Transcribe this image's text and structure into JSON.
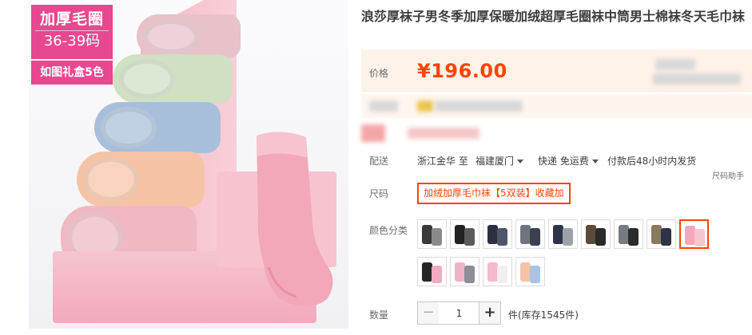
{
  "badge": {
    "line1": "加厚毛圈",
    "line2": "36-39码",
    "sub": "如图礼盒5色"
  },
  "product": {
    "title": "浪莎厚袜子男冬季加厚保暖加绒超厚毛圈袜中筒男士棉袜冬天毛巾袜"
  },
  "price": {
    "label": "价格",
    "value": "¥196.00"
  },
  "shipping": {
    "label": "配送",
    "from": "浙江金华 至",
    "to": "福建厦门",
    "method": "快递 免运费",
    "time": "付款后48小时内发货"
  },
  "size": {
    "helper": "尺码助手",
    "label": "尺码",
    "selected_option": "加绒加厚毛巾袜【5双装】收藏加"
  },
  "colors": {
    "label": "颜色分类",
    "swatches": [
      {
        "name": "mix-gray-black",
        "c1": "#3a3a3a",
        "c2": "#8a8a8a"
      },
      {
        "name": "black-gray",
        "c1": "#222222",
        "c2": "#5a5a5a"
      },
      {
        "name": "navy-black",
        "c1": "#2b3040",
        "c2": "#4d5566"
      },
      {
        "name": "gray-navy",
        "c1": "#6f7580",
        "c2": "#3a4050"
      },
      {
        "name": "navy-gray",
        "c1": "#2e3548",
        "c2": "#9ea2a8"
      },
      {
        "name": "brown-black",
        "c1": "#5b4a3a",
        "c2": "#2a2a2a"
      },
      {
        "name": "gray-black",
        "c1": "#777a80",
        "c2": "#2b2b2b"
      },
      {
        "name": "khaki-navy",
        "c1": "#8a7a5e",
        "c2": "#2d3446"
      },
      {
        "name": "pink-gift-box",
        "c1": "#f2a8b8",
        "c2": "#f7c6d1"
      },
      {
        "name": "black-pink",
        "c1": "#262626",
        "c2": "#f3aac0"
      },
      {
        "name": "pink-gray",
        "c1": "#f0b3c4",
        "c2": "#8d8d95"
      },
      {
        "name": "pink-white",
        "c1": "#f6b9c9",
        "c2": "#f4eef0"
      },
      {
        "name": "multi-pastel",
        "c1": "#f5c3a7",
        "c2": "#a9c4e5"
      }
    ]
  },
  "quantity": {
    "label": "数量",
    "value": "1",
    "minus": "−",
    "plus": "+",
    "stock": "件(库存1545件)"
  },
  "accent": "#ff4400"
}
